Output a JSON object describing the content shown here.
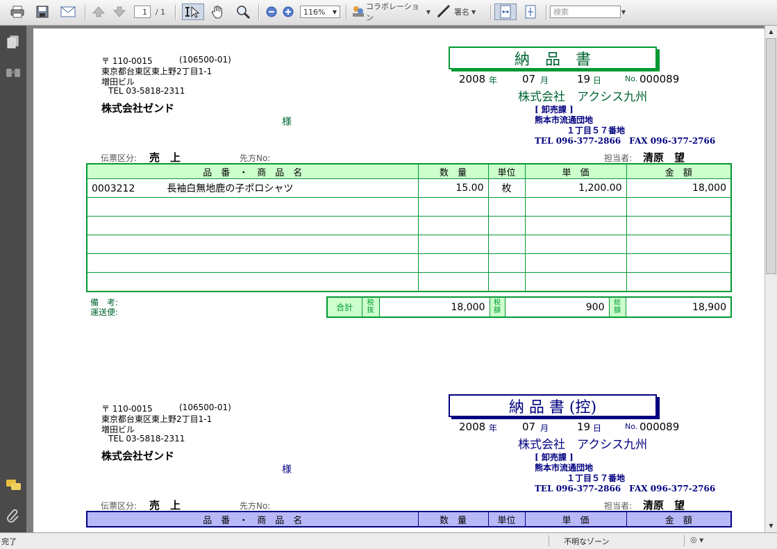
{
  "toolbar": {
    "page_current": "1",
    "page_total": "/ 1",
    "zoom": "116%",
    "collaboration_label": "コラボレーション",
    "sign_label": "署名",
    "search_placeholder": "検索"
  },
  "status": {
    "left": "完了",
    "zone": "不明なゾーン"
  },
  "copies": [
    {
      "title": "納　品　書",
      "sender": {
        "postal": "〒 110-0015",
        "code": "(106500-01)",
        "address1": "東京都台東区東上野2丁目1-1",
        "address2": "増田ビル",
        "tel": "TEL 03-5818-2311",
        "customer": "株式会社ゼンド",
        "honorific": "様"
      },
      "date": {
        "year": "2008",
        "year_unit": "年",
        "month": "07",
        "month_unit": "月",
        "day": "19",
        "day_unit": "日",
        "no_label": "No.",
        "no": "000089"
      },
      "company": {
        "name": "株式会社　アクシス九州",
        "dept": "[ 卸売課 ]",
        "addr1": "熊本市流通団地",
        "addr2": "１丁目５７番地",
        "tel": "TEL 096-377-2866　FAX 096-377-2766"
      },
      "slip_label": "伝票区分:",
      "slip_value": "売　上",
      "dest_label": "先方No:",
      "person_label": "担当者:",
      "person": "清原　望",
      "headers": [
        "品　番　・　商　品　名",
        "数　量",
        "単位",
        "単　価",
        "金　額"
      ],
      "rows": [
        {
          "code": "0003212",
          "name": "長袖白無地鹿の子ポロシャツ",
          "qty": "15.00",
          "unit": "枚",
          "price": "1,200.00",
          "amount": "18,000"
        }
      ],
      "remarks_label": "備　考:",
      "shipping_label": "運送便:",
      "totals": {
        "total_label": "合計",
        "excl_label": "税抜",
        "excl": "18,000",
        "tax_label": "税額",
        "tax": "900",
        "grand_label": "総額",
        "grand": "18,900"
      }
    },
    {
      "title": "納 品 書 (控)",
      "sender": {
        "postal": "〒 110-0015",
        "code": "(106500-01)",
        "address1": "東京都台東区東上野2丁目1-1",
        "address2": "増田ビル",
        "tel": "TEL 03-5818-2311",
        "customer": "株式会社ゼンド",
        "honorific": "様"
      },
      "date": {
        "year": "2008",
        "year_unit": "年",
        "month": "07",
        "month_unit": "月",
        "day": "19",
        "day_unit": "日",
        "no_label": "No.",
        "no": "000089"
      },
      "company": {
        "name": "株式会社　アクシス九州",
        "dept": "[ 卸売課 ]",
        "addr1": "熊本市流通団地",
        "addr2": "１丁目５７番地",
        "tel": "TEL 096-377-2866　FAX 096-377-2766"
      },
      "slip_label": "伝票区分:",
      "slip_value": "売　上",
      "dest_label": "先方No:",
      "person_label": "担当者:",
      "person": "清原　望",
      "headers": [
        "品　番　・　商　品　名",
        "数　量",
        "単位",
        "単　価",
        "金　額"
      ]
    }
  ],
  "colors": {
    "green": "#009933",
    "green_fill": "#ccffcc",
    "blue": "#000080",
    "blue_fill": "#b8b8f8"
  }
}
